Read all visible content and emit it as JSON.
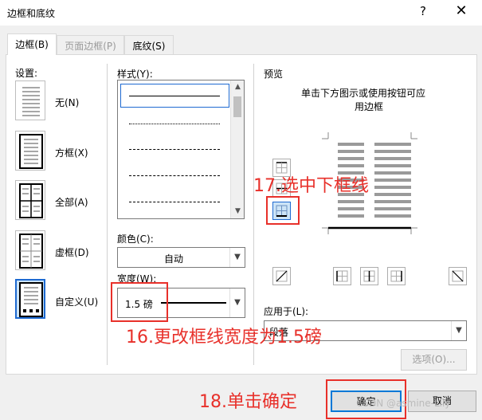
{
  "window": {
    "title": "边框和底纹",
    "help": "?",
    "close": "✕"
  },
  "tabs": [
    {
      "label": "边框(B)",
      "active": true
    },
    {
      "label": "页面边框(P)",
      "active": false
    },
    {
      "label": "底纹(S)",
      "active": false
    }
  ],
  "settings": {
    "label": "设置:",
    "items": [
      {
        "label": "无(N)",
        "icon": "none-setting-icon"
      },
      {
        "label": "方框(X)",
        "icon": "box-setting-icon"
      },
      {
        "label": "全部(A)",
        "icon": "all-setting-icon"
      },
      {
        "label": "虚框(D)",
        "icon": "grid-setting-icon"
      },
      {
        "label": "自定义(U)",
        "icon": "custom-setting-icon",
        "selected": true
      }
    ]
  },
  "style": {
    "label": "样式(Y):"
  },
  "color": {
    "label": "颜色(C):",
    "value": "自动"
  },
  "width": {
    "label": "宽度(W):",
    "value": "1.5 磅"
  },
  "preview": {
    "label": "预览",
    "hint_line1": "单击下方图示或使用按钮可应",
    "hint_line2": "用边框"
  },
  "apply_to": {
    "label": "应用于(L):",
    "value": "段落"
  },
  "buttons": {
    "options": "选项(O)...",
    "ok": "确定",
    "cancel": "取消"
  },
  "annotations": {
    "step17": "17.选中下框线",
    "step16": "16.更改框线宽度为1.5磅",
    "step18": "18.单击确定"
  },
  "watermark": "CSDN @asmine-Lily",
  "colors": {
    "annotation": "#e8302a",
    "selection": "#1e6ad1"
  }
}
